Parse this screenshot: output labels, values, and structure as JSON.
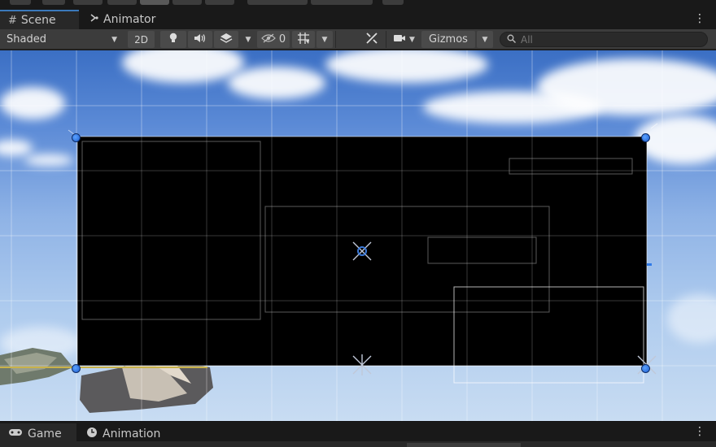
{
  "tabs": [
    {
      "label": "Scene",
      "icon": "hash-icon",
      "active": true
    },
    {
      "label": "Animator",
      "icon": "animator-icon",
      "active": false
    }
  ],
  "toolbar": {
    "shading_mode": "Shaded",
    "mode_2d_label": "2D",
    "hidden_count": "0",
    "gizmos_label": "Gizmos",
    "search_placeholder": "All"
  },
  "bottom_tabs": [
    {
      "label": "Game",
      "icon": "gamepad-icon",
      "active": true
    },
    {
      "label": "Animation",
      "icon": "clock-icon",
      "active": false
    }
  ],
  "colors": {
    "tab_accent": "#3a79bb",
    "toolbar_bg": "#3c3c3c",
    "handle": "#2f7ae8",
    "canvas": "#000000"
  }
}
